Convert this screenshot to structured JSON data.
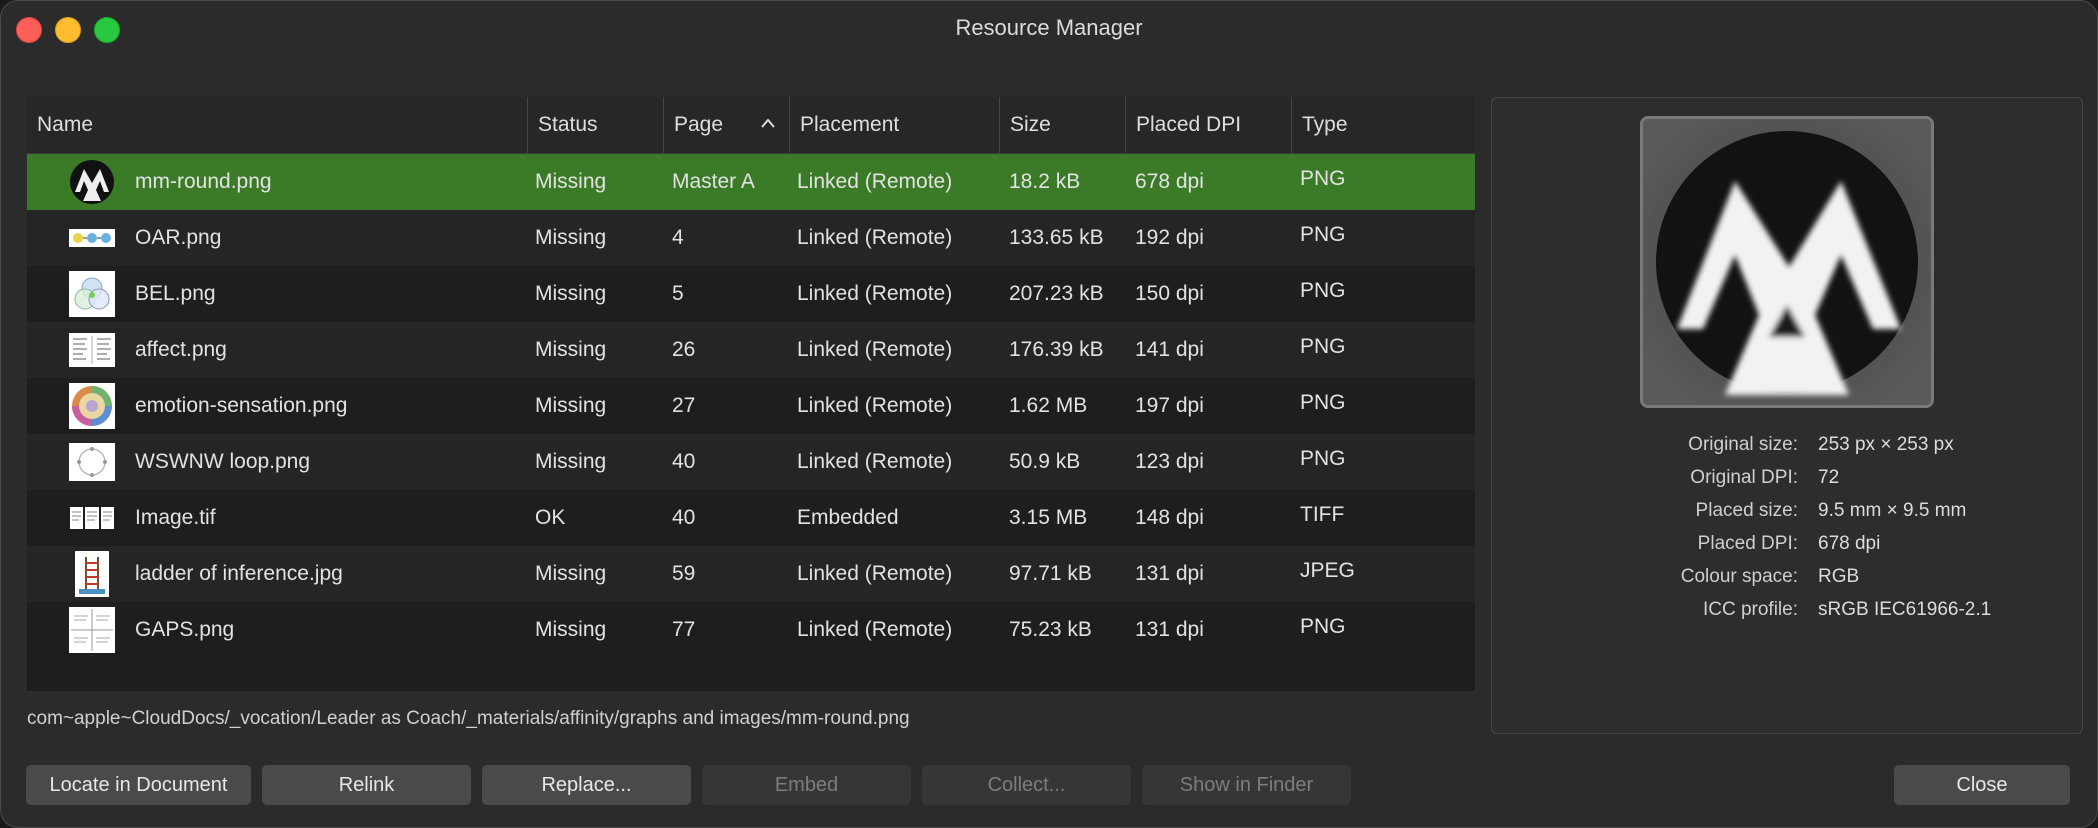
{
  "window": {
    "title": "Resource Manager"
  },
  "columns": {
    "name": "Name",
    "status": "Status",
    "page": "Page",
    "placement": "Placement",
    "size": "Size",
    "placed_dpi": "Placed DPI",
    "type": "Type"
  },
  "rows": [
    {
      "name": "mm-round.png",
      "status": "Missing",
      "page": "Master A",
      "placement": "Linked (Remote)",
      "size": "18.2 kB",
      "dpi": "678 dpi",
      "type": "PNG",
      "thumb": "mm-logo-icon",
      "selected": true
    },
    {
      "name": "OAR.png",
      "status": "Missing",
      "page": "4",
      "placement": "Linked (Remote)",
      "size": "133.65 kB",
      "dpi": "192 dpi",
      "type": "PNG",
      "thumb": "diagram-circles-icon"
    },
    {
      "name": "BEL.png",
      "status": "Missing",
      "page": "5",
      "placement": "Linked (Remote)",
      "size": "207.23 kB",
      "dpi": "150 dpi",
      "type": "PNG",
      "thumb": "venn-diagram-icon"
    },
    {
      "name": "affect.png",
      "status": "Missing",
      "page": "26",
      "placement": "Linked (Remote)",
      "size": "176.39 kB",
      "dpi": "141 dpi",
      "type": "PNG",
      "thumb": "text-grid-icon"
    },
    {
      "name": "emotion-sensation.png",
      "status": "Missing",
      "page": "27",
      "placement": "Linked (Remote)",
      "size": "1.62 MB",
      "dpi": "197 dpi",
      "type": "PNG",
      "thumb": "color-wheel-icon"
    },
    {
      "name": "WSWNW loop.png",
      "status": "Missing",
      "page": "40",
      "placement": "Linked (Remote)",
      "size": "50.9 kB",
      "dpi": "123 dpi",
      "type": "PNG",
      "thumb": "loop-diagram-icon"
    },
    {
      "name": "Image.tif",
      "status": "OK",
      "page": "40",
      "placement": "Embedded",
      "size": "3.15 MB",
      "dpi": "148 dpi",
      "type": "TIFF",
      "thumb": "document-pages-icon"
    },
    {
      "name": "ladder of inference.jpg",
      "status": "Missing",
      "page": "59",
      "placement": "Linked (Remote)",
      "size": "97.71 kB",
      "dpi": "131 dpi",
      "type": "JPEG",
      "thumb": "ladder-icon"
    },
    {
      "name": "GAPS.png",
      "status": "Missing",
      "page": "77",
      "placement": "Linked (Remote)",
      "size": "75.23 kB",
      "dpi": "131 dpi",
      "type": "PNG",
      "thumb": "quadrant-grid-icon"
    }
  ],
  "path": "com~apple~CloudDocs/_vocation/Leader as Coach/_materials/affinity/graphs and images/mm-round.png",
  "info": [
    {
      "label": "Original size:",
      "value": "253 px × 253 px"
    },
    {
      "label": "Original DPI:",
      "value": "72"
    },
    {
      "label": "Placed size:",
      "value": "9.5 mm × 9.5 mm"
    },
    {
      "label": "Placed DPI:",
      "value": "678 dpi"
    },
    {
      "label": "Colour space:",
      "value": "RGB"
    },
    {
      "label": "ICC profile:",
      "value": "sRGB IEC61966-2.1"
    }
  ],
  "buttons": {
    "locate": "Locate in Document",
    "relink": "Relink",
    "replace": "Replace...",
    "embed": "Embed",
    "collect": "Collect...",
    "show_in_finder": "Show in Finder",
    "close": "Close"
  },
  "colors": {
    "selection": "#3b7b27",
    "window_bg": "#2b2b2b"
  }
}
